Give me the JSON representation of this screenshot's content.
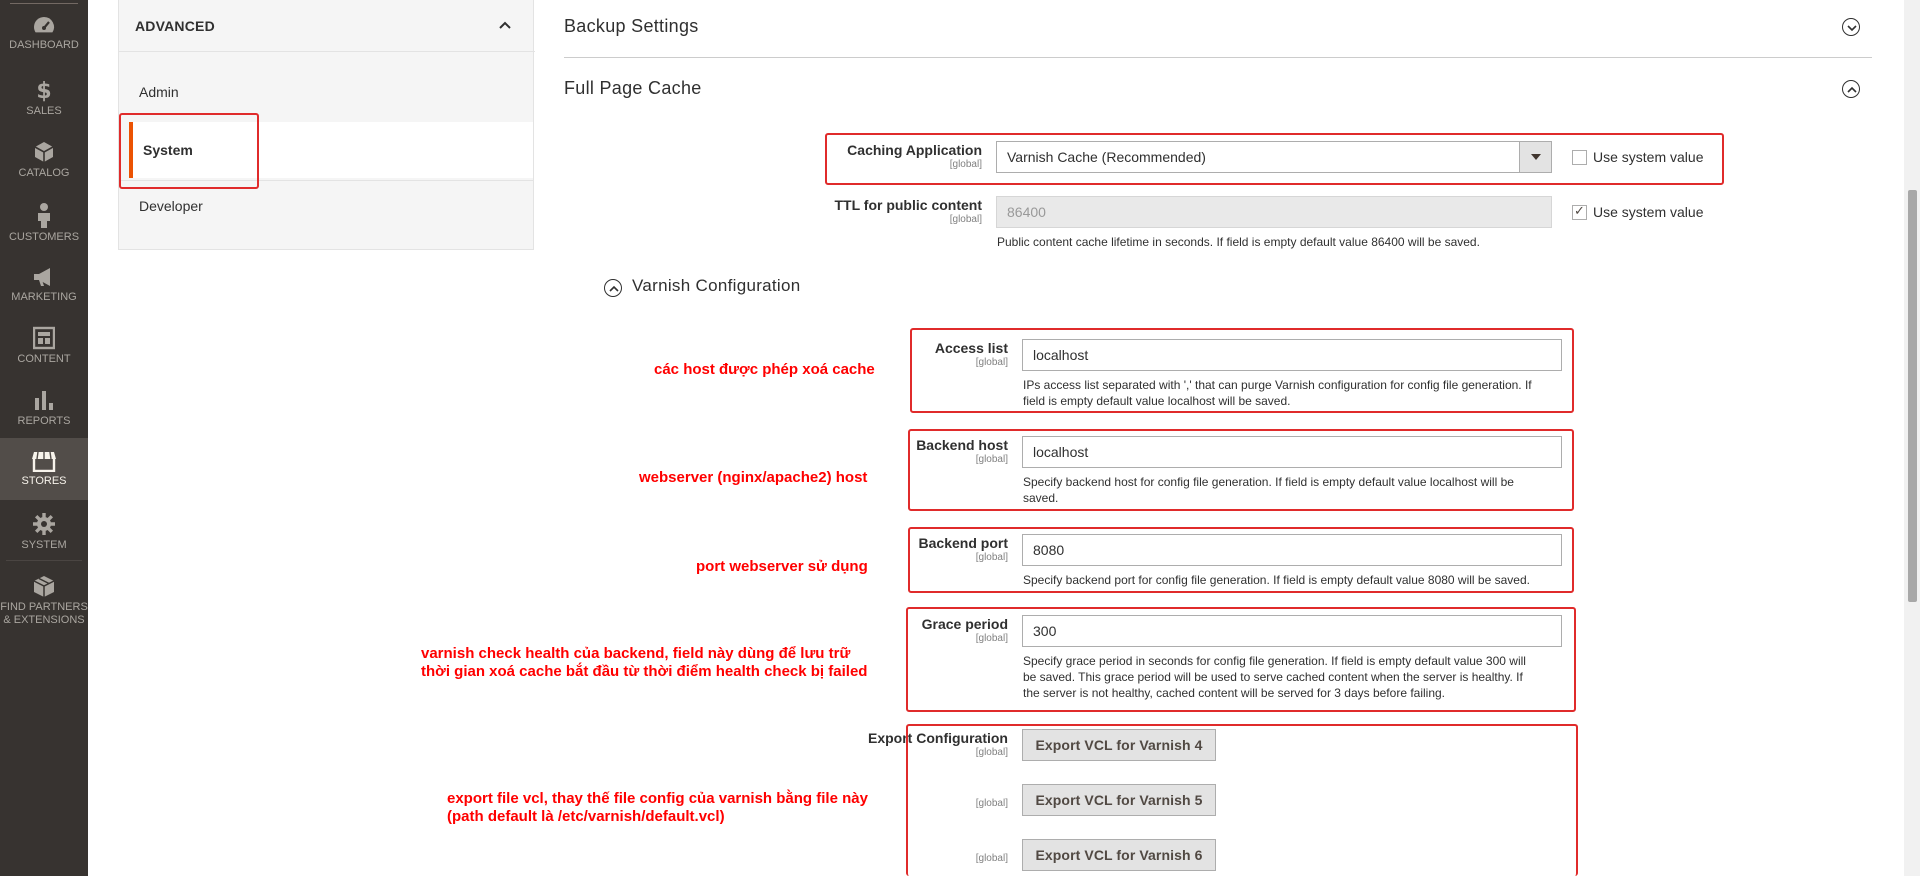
{
  "nav": {
    "items": [
      {
        "label": "DASHBOARD",
        "icon": "dashboard-icon"
      },
      {
        "label": "SALES",
        "icon": "dollar-icon"
      },
      {
        "label": "CATALOG",
        "icon": "cube-icon"
      },
      {
        "label": "CUSTOMERS",
        "icon": "person-icon"
      },
      {
        "label": "MARKETING",
        "icon": "megaphone-icon"
      },
      {
        "label": "CONTENT",
        "icon": "layout-icon"
      },
      {
        "label": "REPORTS",
        "icon": "bar-chart-icon"
      },
      {
        "label": "STORES",
        "icon": "store-icon"
      },
      {
        "label": "SYSTEM",
        "icon": "gear-icon"
      },
      {
        "label": "FIND PARTNERS",
        "label2": "& EXTENSIONS",
        "icon": "box-icon"
      }
    ]
  },
  "tabs": {
    "title": "ADVANCED",
    "items": [
      "Admin",
      "System",
      "Developer"
    ],
    "active": "System"
  },
  "sections": {
    "backup": "Backup Settings",
    "fpc": "Full Page Cache",
    "varnish": "Varnish Configuration"
  },
  "fields": {
    "caching_app": {
      "label": "Caching Application",
      "scope": "[global]",
      "value": "Varnish Cache (Recommended)",
      "use_system": "Use system value",
      "use_system_checked": false
    },
    "ttl": {
      "label": "TTL for public content",
      "scope": "[global]",
      "value": "86400",
      "use_system": "Use system value",
      "use_system_checked": true,
      "hint": "Public content cache lifetime in seconds. If field is empty default value 86400 will be saved."
    },
    "access_list": {
      "label": "Access list",
      "scope": "[global]",
      "value": "localhost",
      "hint1": "IPs access list separated with ',' that can purge Varnish configuration for config file generation. If",
      "hint2": "field is empty default value localhost will be saved."
    },
    "backend_host": {
      "label": "Backend host",
      "scope": "[global]",
      "value": "localhost",
      "hint1": "Specify backend host for config file generation. If field is empty default value localhost will be",
      "hint2": "saved."
    },
    "backend_port": {
      "label": "Backend port",
      "scope": "[global]",
      "value": "8080",
      "hint1": "Specify backend port for config file generation. If field is empty default value 8080 will be saved."
    },
    "grace": {
      "label": "Grace period",
      "scope": "[global]",
      "value": "300",
      "hint1": "Specify grace period in seconds for config file generation. If field is empty default value 300 will",
      "hint2": "be saved. This grace period will be used to serve cached content when the server is healthy. If",
      "hint3": "the server is not healthy, cached content will be served for 3 days before failing."
    },
    "export": {
      "label": "Export Configuration",
      "scope": "[global]",
      "buttons": [
        "Export VCL for Varnish 4",
        "Export VCL for Varnish 5",
        "Export VCL for Varnish 6"
      ]
    }
  },
  "annotations": {
    "access": "các host được phép xoá cache",
    "host": "webserver (nginx/apache2) host",
    "port": "port webserver sử dụng",
    "grace1": "varnish check health của backend, field này dùng để lưu trữ",
    "grace2": "thời gian xoá cache bắt đầu từ thời điểm health check bị failed",
    "export1": "export file vcl, thay thế file config của varnish bằng file này",
    "export2": "(path default là /etc/varnish/default.vcl)"
  },
  "colors": {
    "annotation": "#ff0000",
    "active_tab_accent": "#eb5202",
    "nav_bg": "#373330"
  }
}
